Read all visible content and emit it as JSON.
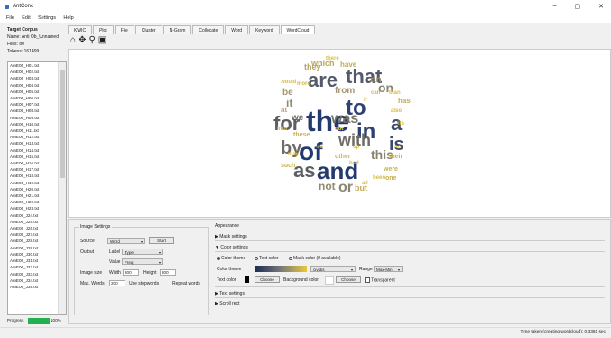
{
  "window": {
    "title": "AntConc",
    "minimize": "–",
    "maximize": "▢",
    "close": "✕"
  },
  "menu": [
    "File",
    "Edit",
    "Settings",
    "Help"
  ],
  "left": {
    "target_corpus": "Target Corpus",
    "name": "Name: Anti Ob_Unnamed",
    "files": "Files: 80",
    "tokens": "Tokens: 161499",
    "files_list": [
      "AmE06_H01.txt",
      "AmE06_H02.txt",
      "AmE06_H03.txt",
      "AmE06_H04.txt",
      "AmE06_H05.txt",
      "AmE06_H06.txt",
      "AmE06_H07.txt",
      "AmE06_H08.txt",
      "AmE06_H09.txt",
      "AmE06_H10.txt",
      "AmE06_H11.txt",
      "AmE06_H12.txt",
      "AmE06_H13.txt",
      "AmE06_H14.txt",
      "AmE06_H15.txt",
      "AmE06_H16.txt",
      "AmE06_H17.txt",
      "AmE06_H18.txt",
      "AmE06_H19.txt",
      "AmE06_H20.txt",
      "AmE06_H21.txt",
      "AmE06_H22.txt",
      "AmE06_H23.txt",
      "AmE06_J24.txt",
      "AmE06_J25.txt",
      "AmE06_J26.txt",
      "AmE06_J27.txt",
      "AmE06_J28.txt",
      "AmE06_J29.txt",
      "AmE06_J30.txt",
      "AmE06_J31.txt",
      "AmE06_J32.txt",
      "AmE06_J33.txt",
      "AmE06_J34.txt",
      "AmE06_J35.txt"
    ],
    "progress_label": "Progress",
    "progress_value": "100%",
    "progress_fraction": 1.0
  },
  "tabs": [
    "KWIC",
    "Plot",
    "File",
    "Cluster",
    "N-Gram",
    "Collocate",
    "Word",
    "Keyword",
    "WordCloud"
  ],
  "active_tab": "WordCloud",
  "toolbar_icons": [
    "home-icon",
    "move-icon",
    "zoom-icon",
    "save-icon"
  ],
  "wordcloud": {
    "words": [
      {
        "t": "the",
        "c": "#223a6e"
      },
      {
        "t": "and",
        "c": "#223a6e"
      },
      {
        "t": "of",
        "c": "#223a6e"
      },
      {
        "t": "to",
        "c": "#2e4272"
      },
      {
        "t": "in",
        "c": "#2e4272"
      },
      {
        "t": "is",
        "c": "#3b4a70"
      },
      {
        "t": "a",
        "c": "#3b4a70"
      },
      {
        "t": "that",
        "c": "#555a6a"
      },
      {
        "t": "are",
        "c": "#555a6a"
      },
      {
        "t": "for",
        "c": "#5c5e62"
      },
      {
        "t": "as",
        "c": "#5c5e62"
      },
      {
        "t": "by",
        "c": "#6d6c66"
      },
      {
        "t": "with",
        "c": "#6d6c66"
      },
      {
        "t": "was",
        "c": "#77746a"
      },
      {
        "t": "this",
        "c": "#8a8570"
      },
      {
        "t": "on",
        "c": "#8a8570"
      },
      {
        "t": "or",
        "c": "#8a8570"
      },
      {
        "t": "not",
        "c": "#908a6c"
      },
      {
        "t": "it",
        "c": "#908a6c"
      },
      {
        "t": "be",
        "c": "#a09570"
      },
      {
        "t": "we",
        "c": "#6d6c66"
      },
      {
        "t": "from",
        "c": "#a09570"
      },
      {
        "t": "an",
        "c": "#a09570"
      },
      {
        "t": "which",
        "c": "#b8a560"
      },
      {
        "t": "they",
        "c": "#b8a560"
      },
      {
        "t": "at",
        "c": "#b8a560"
      },
      {
        "t": "but",
        "c": "#c2ab55"
      },
      {
        "t": "have",
        "c": "#c2ab55"
      },
      {
        "t": "has",
        "c": "#c2ab55"
      },
      {
        "t": "these",
        "c": "#c9b050"
      },
      {
        "t": "were",
        "c": "#c9b050"
      },
      {
        "t": "one",
        "c": "#c9b050"
      },
      {
        "t": "their",
        "c": "#ccb24c"
      },
      {
        "t": "such",
        "c": "#ccb24c"
      },
      {
        "t": "other",
        "c": "#d0b54a"
      },
      {
        "t": "more",
        "c": "#d0b54a"
      },
      {
        "t": "also",
        "c": "#d4b846"
      },
      {
        "t": "all",
        "c": "#d4b846"
      },
      {
        "t": "can",
        "c": "#d4b846"
      },
      {
        "t": "would",
        "c": "#d8bb44"
      },
      {
        "t": "there",
        "c": "#d8bb44"
      },
      {
        "t": "been",
        "c": "#d8bb44"
      },
      {
        "t": "its",
        "c": "#d8bb44"
      },
      {
        "t": "had",
        "c": "#dcbd42"
      },
      {
        "t": "may",
        "c": "#dcbd42"
      },
      {
        "t": "if",
        "c": "#dcbd42"
      },
      {
        "t": "than",
        "c": "#dcbd42"
      },
      {
        "t": "so",
        "c": "#e0c040"
      },
      {
        "t": "into",
        "c": "#e0c040"
      },
      {
        "t": "no",
        "c": "#e0c040"
      },
      {
        "t": "up",
        "c": "#e0c040"
      },
      {
        "t": "out",
        "c": "#e0c040"
      }
    ]
  },
  "image_settings": {
    "title": "Image Settings",
    "source_label": "Source",
    "source_value": "Word",
    "start_label": "Start",
    "output_label": "Output",
    "label_label": "Label",
    "label_value": "Type",
    "value_label": "Value",
    "value_value": "Freq",
    "image_size_label": "Image size",
    "width_label": "Width",
    "width_value": "300",
    "height_label": "Height",
    "height_value": "300",
    "max_words_label": "Max. Words",
    "max_words_value": "200",
    "use_stopwords": "Use stopwords",
    "repeat_words": "Repeat words"
  },
  "appearance": {
    "title": "Appearance",
    "mask_settings": "Mask settings",
    "color_settings": "Color settings",
    "color_theme_radio": "Color theme",
    "text_color_radio": "Text color",
    "mask_color_radio": "Mask color (if available)",
    "color_theme_label": "Color theme",
    "cmap_value": "cividis",
    "range_label": "Range",
    "range_value": "Max-Min",
    "text_color_label": "Text color",
    "choose_label": "Choose",
    "background_color_label": "Background color",
    "choose2_label": "Choose",
    "transparent_label": "Transparent",
    "text_settings": "Text settings",
    "scroll_rect": "Scroll rect"
  },
  "status": "Time taken (creating wordcloud): 0.3381 sec"
}
